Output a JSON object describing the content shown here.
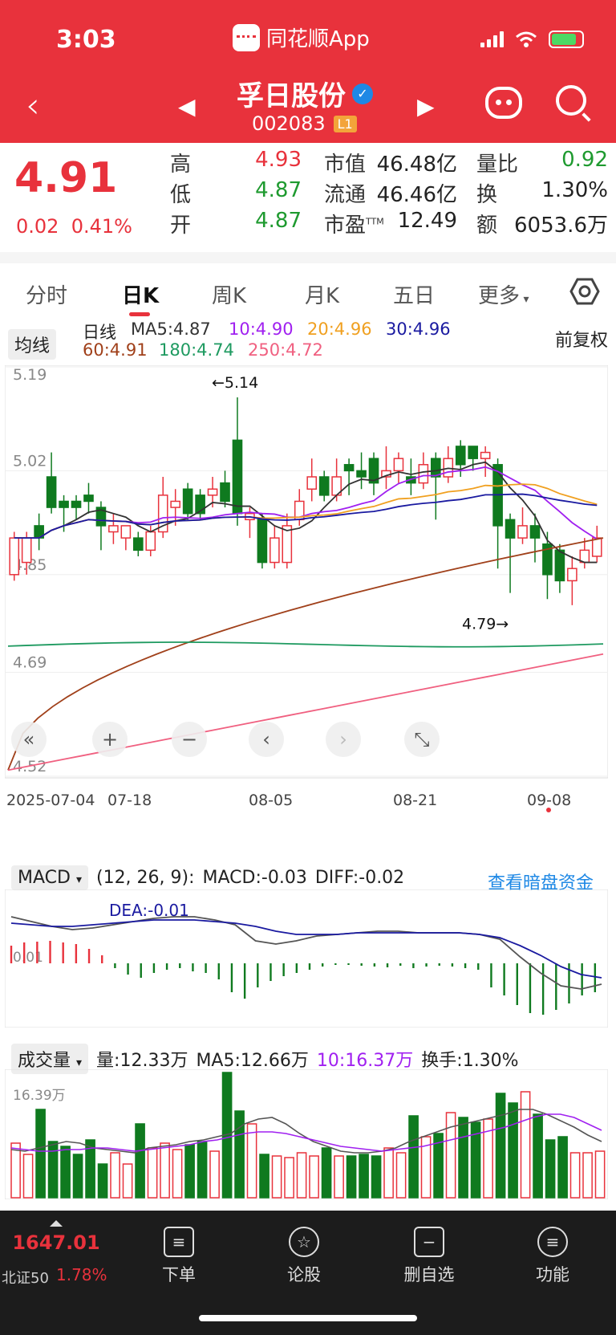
{
  "status_bar": {
    "time": "3:03",
    "app_name": "同花顺App"
  },
  "nav": {
    "stock_name": "孚日股份",
    "stock_code": "002083",
    "level_badge": "L1"
  },
  "quote": {
    "price": "4.91",
    "change": "0.02",
    "change_pct": "0.41%",
    "high_label": "高",
    "high": "4.93",
    "low_label": "低",
    "low": "4.87",
    "open_label": "开",
    "open": "4.87",
    "mktcap_label": "市值",
    "mktcap": "46.48亿",
    "float_label": "流通",
    "float": "46.46亿",
    "pe_label": "市盈",
    "pe_sup": "TTM",
    "pe": "12.49",
    "volratio_label": "量比",
    "volratio": "0.92",
    "turnover_label": "换",
    "turnover": "1.30%",
    "amount_label": "额",
    "amount": "6053.6万"
  },
  "tabs": [
    "分时",
    "日K",
    "周K",
    "月K",
    "五日",
    "更多"
  ],
  "active_tab": "日K",
  "ma_legend": {
    "button": "均线",
    "period": "日线",
    "fq": "前复权",
    "items": [
      {
        "text": "MA5:4.87",
        "color": "#333333"
      },
      {
        "text": "10:4.90",
        "color": "#a020f0"
      },
      {
        "text": "20:4.96",
        "color": "#f0a020"
      },
      {
        "text": "30:4.96",
        "color": "#1a1aa0"
      },
      {
        "text": "60:4.91",
        "color": "#a0401a"
      },
      {
        "text": "180:4.74",
        "color": "#1e9a60"
      },
      {
        "text": "250:4.72",
        "color": "#f06080"
      }
    ]
  },
  "chart_data": {
    "type": "candlestick",
    "y_ticks": [
      "5.19",
      "5.02",
      "4.85",
      "4.69",
      "4.52"
    ],
    "x_ticks": [
      "2025-07-04",
      "07-18",
      "08-05",
      "08-21",
      "09-08"
    ],
    "ylim": [
      4.52,
      5.19
    ],
    "annotations": {
      "high": "←5.14",
      "low": "4.79→"
    },
    "candles": [
      [
        4.85,
        4.91,
        4.84,
        4.92
      ],
      [
        4.87,
        4.91,
        4.85,
        4.92
      ],
      [
        4.93,
        4.91,
        4.89,
        4.95
      ],
      [
        5.01,
        4.96,
        4.95,
        5.05
      ],
      [
        4.97,
        4.96,
        4.92,
        4.98
      ],
      [
        4.97,
        4.96,
        4.94,
        4.98
      ],
      [
        4.98,
        4.97,
        4.95,
        5.0
      ],
      [
        4.96,
        4.93,
        4.89,
        4.97
      ],
      [
        4.92,
        4.93,
        4.9,
        4.95
      ],
      [
        4.91,
        4.93,
        4.89,
        4.93
      ],
      [
        4.91,
        4.89,
        4.88,
        4.92
      ],
      [
        4.89,
        4.92,
        4.88,
        4.93
      ],
      [
        4.92,
        4.98,
        4.91,
        5.01
      ],
      [
        4.96,
        4.97,
        4.93,
        4.99
      ],
      [
        4.99,
        4.95,
        4.94,
        5.0
      ],
      [
        4.98,
        4.95,
        4.94,
        4.99
      ],
      [
        4.98,
        4.99,
        4.96,
        5.01
      ],
      [
        5.0,
        4.97,
        4.96,
        5.02
      ],
      [
        5.07,
        4.95,
        4.93,
        5.14
      ],
      [
        4.94,
        4.95,
        4.91,
        4.96
      ],
      [
        4.94,
        4.87,
        4.86,
        4.95
      ],
      [
        4.87,
        4.91,
        4.86,
        4.93
      ],
      [
        4.87,
        4.93,
        4.86,
        4.95
      ],
      [
        4.94,
        4.97,
        4.93,
        4.99
      ],
      [
        4.99,
        5.01,
        4.97,
        5.04
      ],
      [
        5.01,
        4.98,
        4.97,
        5.02
      ],
      [
        4.98,
        5.01,
        4.97,
        5.04
      ],
      [
        5.03,
        5.02,
        4.98,
        5.04
      ],
      [
        5.02,
        5.01,
        4.99,
        5.05
      ],
      [
        5.04,
        5.0,
        4.98,
        5.05
      ],
      [
        5.01,
        5.02,
        4.99,
        5.06
      ],
      [
        5.02,
        5.04,
        5.0,
        5.05
      ],
      [
        5.01,
        5.0,
        4.98,
        5.04
      ],
      [
        5.0,
        5.03,
        4.99,
        5.05
      ],
      [
        5.04,
        5.01,
        4.94,
        5.05
      ],
      [
        5.01,
        5.04,
        5.0,
        5.06
      ],
      [
        5.06,
        5.03,
        5.01,
        5.07
      ],
      [
        5.06,
        5.04,
        5.02,
        5.06
      ],
      [
        5.04,
        5.05,
        5.01,
        5.06
      ],
      [
        5.03,
        4.93,
        4.86,
        5.04
      ],
      [
        4.94,
        4.91,
        4.82,
        4.95
      ],
      [
        4.91,
        4.93,
        4.9,
        4.96
      ],
      [
        4.93,
        4.91,
        4.87,
        4.95
      ],
      [
        4.9,
        4.85,
        4.81,
        4.92
      ],
      [
        4.89,
        4.84,
        4.82,
        4.9
      ],
      [
        4.84,
        4.86,
        4.8,
        4.88
      ],
      [
        4.87,
        4.89,
        4.86,
        4.91
      ],
      [
        4.88,
        4.91,
        4.87,
        4.93
      ]
    ]
  },
  "macd": {
    "button": "MACD",
    "params": "(12, 26, 9):",
    "macd": "MACD:-0.03",
    "diff": "DIFF:-0.02",
    "dea": "DEA:-0.01",
    "link": "查看暗盘资金",
    "axis": "0.01"
  },
  "volume": {
    "button": "成交量",
    "vol": "量:12.33万",
    "ma5": "MA5:12.66万",
    "ma10": "10:16.37万",
    "turnover": "换手:1.30%",
    "axis": "16.39万"
  },
  "chart_controls": [
    "«",
    "+",
    "−",
    "‹",
    "›",
    "⤡"
  ],
  "bottom": {
    "index_value": "1647.01",
    "index_name": "北证50",
    "index_change": "1.78%",
    "items": [
      {
        "label": "下单",
        "icon": "order-icon"
      },
      {
        "label": "论股",
        "icon": "discuss-icon"
      },
      {
        "label": "删自选",
        "icon": "remove-watch-icon"
      },
      {
        "label": "功能",
        "icon": "menu-icon"
      }
    ]
  }
}
